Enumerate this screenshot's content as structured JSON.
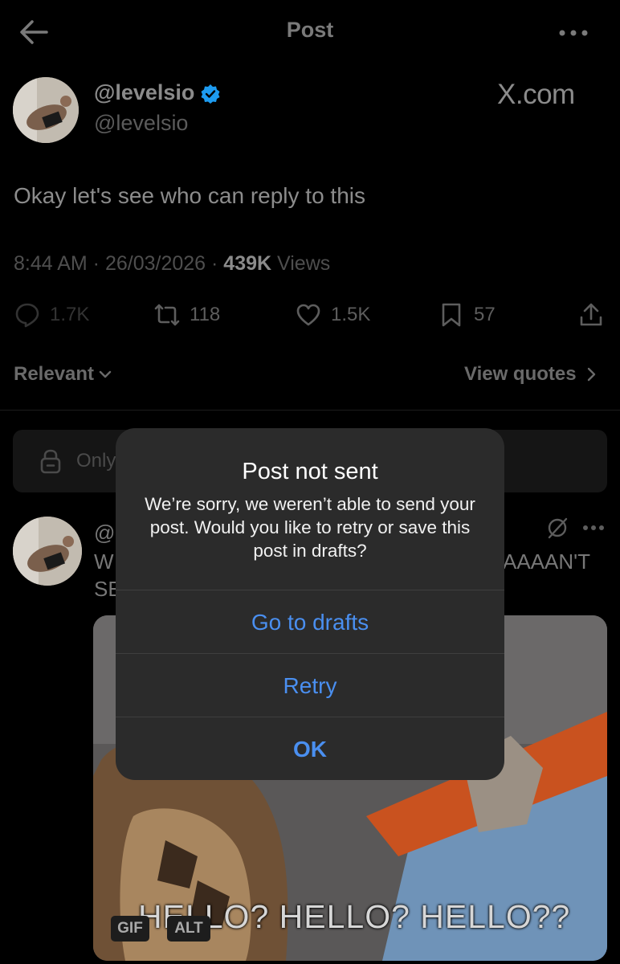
{
  "header": {
    "title": "Post"
  },
  "author": {
    "display_name": "@levelsio",
    "handle": "@levelsio",
    "watermark": "X.com"
  },
  "post": {
    "text": "Okay let's see who can reply to this",
    "time": "8:44 AM",
    "date": "26/03/2026",
    "views_count": "439K",
    "views_label": "Views"
  },
  "actions": {
    "replies": "1.7K",
    "reposts": "118",
    "likes": "1.5K",
    "bookmarks": "57"
  },
  "filters": {
    "relevant": "Relevant",
    "view_quotes": "View quotes"
  },
  "restriction": {
    "text": "Only"
  },
  "reply": {
    "handle_partial": "@l",
    "line1_partial": "W",
    "line2_partial": "SE",
    "line1_right": "AAAAN'T",
    "gif_label": "GIF",
    "alt_label": "ALT",
    "caption": "HELLO? HELLO? HELLO??"
  },
  "alert": {
    "title": "Post not sent",
    "message": "We’re sorry, we weren’t able to send your post. Would you like to retry or save this post in drafts?",
    "buttons": {
      "drafts": "Go to drafts",
      "retry": "Retry",
      "ok": "OK"
    }
  },
  "colors": {
    "background": "#000000",
    "accent_blue": "#4a8ff0",
    "verified_blue": "#1d9bf0",
    "alert_bg": "#2b2b2b"
  }
}
